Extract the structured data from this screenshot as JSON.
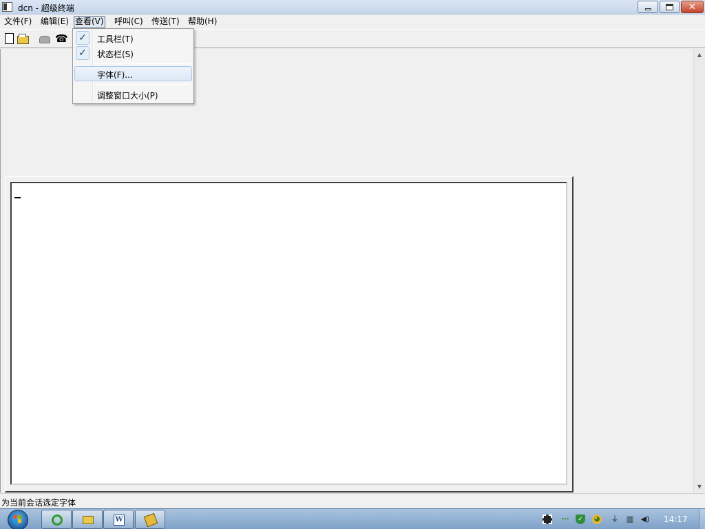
{
  "window": {
    "title": "dcn - 超级终端"
  },
  "menubar": {
    "items": [
      {
        "label": "文件(F)"
      },
      {
        "label": "编辑(E)"
      },
      {
        "label": "查看(V)"
      },
      {
        "label": "呼叫(C)"
      },
      {
        "label": "传送(T)"
      },
      {
        "label": "帮助(H)"
      }
    ],
    "active_item": "查看(V)"
  },
  "view_menu": {
    "items": [
      {
        "label": "工具栏(T)",
        "checked": true
      },
      {
        "label": "状态栏(S)",
        "checked": true
      },
      {
        "label": "字体(F)...",
        "checked": false,
        "highlighted": true
      },
      {
        "label": "调整窗口大小(P)",
        "checked": false
      }
    ],
    "check_glyph": "✓"
  },
  "toolbar": {
    "icons": [
      "new-document-icon",
      "open-folder-icon",
      "phone-icon",
      "hangup-icon"
    ]
  },
  "statusbar": {
    "text": "为当前会话选定字体"
  },
  "taskbar": {
    "clock": "14:17",
    "pinned": [
      "internet-explorer-icon",
      "windows-explorer-icon",
      "word-icon",
      "hyperterminal-icon"
    ],
    "tray_icons": [
      "filmstrip-icon",
      "network-dots-icon",
      "shield-icon",
      "antivirus-icon",
      "plug-icon",
      "network-icon",
      "volume-icon"
    ]
  },
  "colors": {
    "titlebar": "#c4d5ea",
    "taskbar": "#7fa2c8",
    "menu_highlight": "#dce8f6",
    "close_button": "#c4442a"
  }
}
